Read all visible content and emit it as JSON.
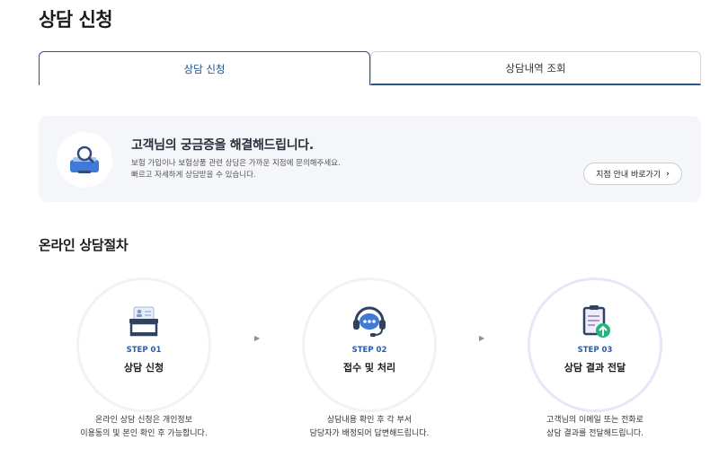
{
  "page": {
    "title": "상담 신청"
  },
  "tabs": [
    {
      "label": "상담 신청",
      "active": true
    },
    {
      "label": "상담내역 조회",
      "active": false
    }
  ],
  "info": {
    "icon": "search-mailbox-icon",
    "title": "고객님의 궁금증을 해결해드립니다.",
    "line1": "보험 가입이나 보험상품 관련 상담은 가까운 지점에 문의해주세요.",
    "line2": "빠르고 자세하게 상담받을 수 있습니다.",
    "button_label": "지점 안내 바로가기",
    "button_chevron": "›"
  },
  "procedure": {
    "title": "온라인 상담절차",
    "arrow": "▶",
    "steps": [
      {
        "step": "STEP 01",
        "name": "상담 신청",
        "icon": "application-form-icon",
        "desc1": "온라인 상담 신청은 개인정보",
        "desc2": "이용동의 및 본인 확인 후 가능합니다."
      },
      {
        "step": "STEP 02",
        "name": "접수 및 처리",
        "icon": "headset-chat-icon",
        "desc1": "상담내용 확인 후 각 부서",
        "desc2": "담당자가 배정되어 답변해드립니다."
      },
      {
        "step": "STEP 03",
        "name": "상담 결과 전달",
        "icon": "clipboard-upload-icon",
        "desc1": "고객님의 이메일 또는 전화로",
        "desc2": "상담 결과를 전달해드립니다."
      }
    ]
  },
  "colors": {
    "accent": "#2b5590",
    "step_label": "#2d5aa8",
    "info_bg": "#f4f6fa"
  }
}
